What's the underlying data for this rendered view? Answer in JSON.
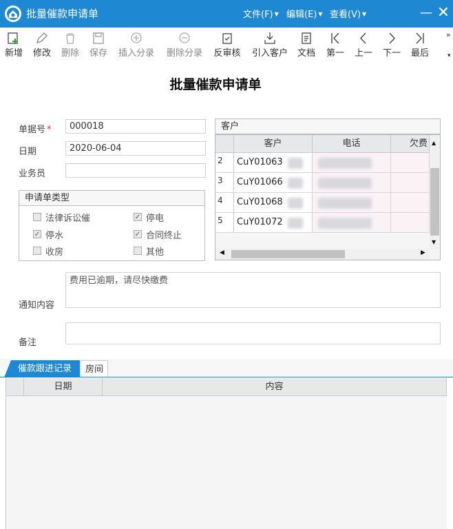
{
  "window": {
    "title": "批量催款申请单",
    "menus": [
      "文件(F)",
      "编辑(E)",
      "查看(V)"
    ]
  },
  "toolbar": {
    "items": [
      {
        "label": "新增",
        "icon": "add-document-icon",
        "enabled": true
      },
      {
        "label": "修改",
        "icon": "edit-icon",
        "enabled": true
      },
      {
        "label": "删除",
        "icon": "trash-icon",
        "enabled": false
      },
      {
        "label": "保存",
        "icon": "save-icon",
        "enabled": false
      },
      {
        "label": "插入分录",
        "icon": "plus-circle-icon",
        "enabled": false
      },
      {
        "label": "删除分录",
        "icon": "minus-circle-icon",
        "enabled": false
      },
      {
        "label": "反审核",
        "icon": "clipboard-check-icon",
        "enabled": true
      },
      {
        "label": "引入客户",
        "icon": "import-icon",
        "enabled": true
      },
      {
        "label": "文档",
        "icon": "document-icon",
        "enabled": true
      },
      {
        "label": "第一",
        "icon": "first-icon",
        "enabled": true
      },
      {
        "label": "上一",
        "icon": "previous-icon",
        "enabled": true
      },
      {
        "label": "下一",
        "icon": "next-icon",
        "enabled": true
      },
      {
        "label": "最后",
        "icon": "last-icon",
        "enabled": true
      }
    ]
  },
  "form": {
    "title": "批量催款申请单",
    "doc_no_label": "单据号",
    "doc_no": "000018",
    "date_label": "日期",
    "date": "2020-06-04",
    "staff_label": "业务员",
    "staff": "",
    "type_group_title": "申请单类型",
    "types": [
      {
        "label": "法律诉讼催",
        "checked": false
      },
      {
        "label": "停电",
        "checked": true
      },
      {
        "label": "停水",
        "checked": true
      },
      {
        "label": "合同终止",
        "checked": true
      },
      {
        "label": "收房",
        "checked": false
      },
      {
        "label": "其他",
        "checked": false
      }
    ],
    "notice_label": "通知内容",
    "notice": "费用已逾期，请尽快缴费",
    "remark_label": "备注",
    "remark": ""
  },
  "customers": {
    "group_title": "客户",
    "columns": [
      "客户",
      "电话",
      "欠费"
    ],
    "rows": [
      {
        "no": "2",
        "customer": "CuY01063"
      },
      {
        "no": "3",
        "customer": "CuY01066"
      },
      {
        "no": "4",
        "customer": "CuY01068"
      },
      {
        "no": "5",
        "customer": "CuY01072"
      }
    ]
  },
  "tabs": [
    "催款跟进记录",
    "房间"
  ],
  "followup": {
    "columns": [
      "日期",
      "内容"
    ]
  },
  "colors": {
    "titlebar": "#1e88d2",
    "tab_active": "#1e88d2"
  }
}
